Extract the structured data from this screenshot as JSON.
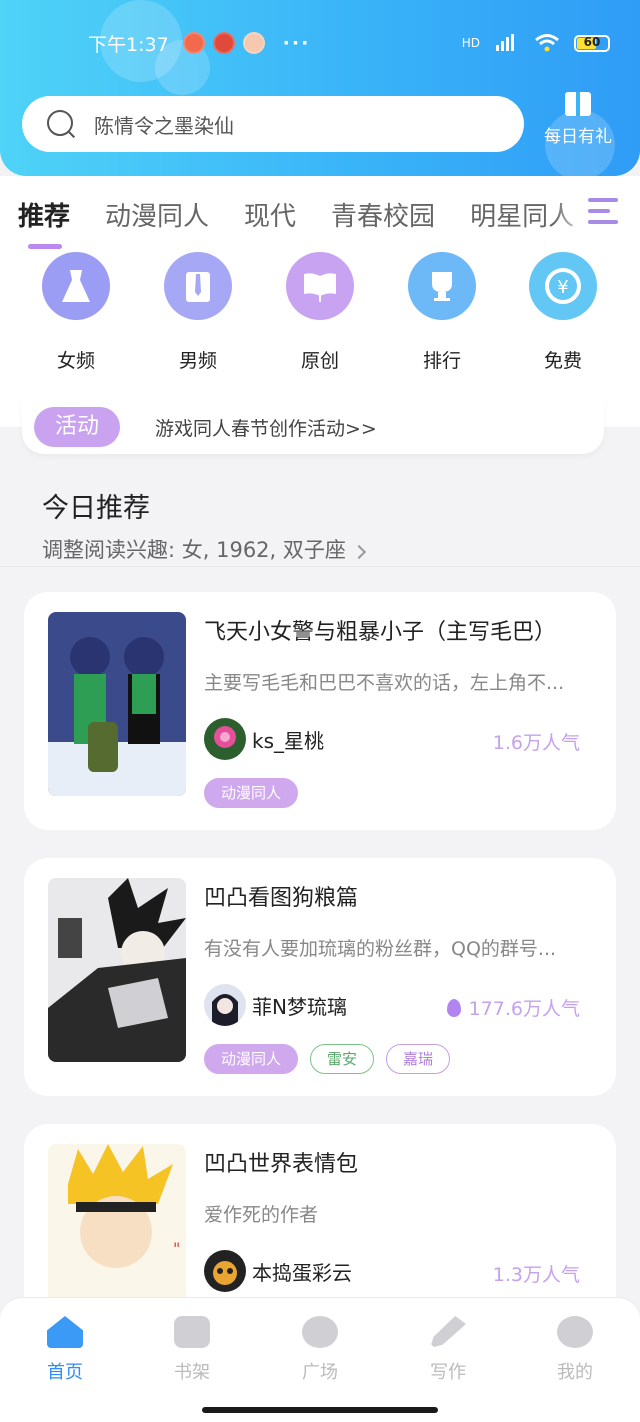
{
  "status_bar": {
    "time": "下午1:37",
    "dots": "···",
    "network": "HD",
    "battery": "60"
  },
  "search": {
    "placeholder": "陈情令之墨染仙"
  },
  "daily_gift": {
    "label": "每日有礼"
  },
  "tabs": [
    "推荐",
    "动漫同人",
    "现代",
    "青春校园",
    "明星同人"
  ],
  "categories": [
    {
      "label": "女频",
      "color": "#9b9cf3",
      "icon": "dress-icon"
    },
    {
      "label": "男频",
      "color": "#a6a8f5",
      "icon": "shirt-icon"
    },
    {
      "label": "原创",
      "color": "#c7a3f2",
      "icon": "book-icon"
    },
    {
      "label": "排行",
      "color": "#6db8f7",
      "icon": "trophy-icon"
    },
    {
      "label": "免费",
      "color": "#62c7f4",
      "icon": "yen-coin-icon"
    }
  ],
  "activity": {
    "badge": "活动",
    "text": "游戏同人春节创作活动>>"
  },
  "section": {
    "title": "今日推荐",
    "subtitle": "调整阅读兴趣: 女, 1962, 双子座"
  },
  "cards": [
    {
      "title": "飞天小女警与粗暴小子（主写毛巴）",
      "desc": "主要写毛毛和巴巴不喜欢的话，左上角不...",
      "author": "ks_星桃",
      "popularity": "1.6万人气",
      "hot": false,
      "tags": [
        {
          "text": "动漫同人",
          "style": "fill"
        }
      ]
    },
    {
      "title": "凹凸看图狗粮篇",
      "desc": "有没有人要加琉璃的粉丝群，QQ的群号...",
      "author": "菲N梦琉璃",
      "popularity": "177.6万人气",
      "hot": true,
      "tags": [
        {
          "text": "动漫同人",
          "style": "fill"
        },
        {
          "text": "雷安",
          "style": "green"
        },
        {
          "text": "嘉瑞",
          "style": "pink"
        }
      ]
    },
    {
      "title": "凹凸世界表情包",
      "desc": "爱作死的作者",
      "author": "本捣蛋彩云",
      "popularity": "1.3万人气",
      "hot": false,
      "tags": []
    }
  ],
  "bottom_nav": [
    {
      "label": "首页",
      "icon": "home-icon",
      "active": true
    },
    {
      "label": "书架",
      "icon": "bookshelf-icon",
      "active": false
    },
    {
      "label": "广场",
      "icon": "planet-icon",
      "active": false
    },
    {
      "label": "写作",
      "icon": "pen-icon",
      "active": false
    },
    {
      "label": "我的",
      "icon": "chat-face-icon",
      "active": false
    }
  ],
  "colors": {
    "header_start": "#4fd3f7",
    "header_end": "#2f9cf6",
    "accent_purple": "#b989f0",
    "nav_active": "#2f8ef5"
  }
}
